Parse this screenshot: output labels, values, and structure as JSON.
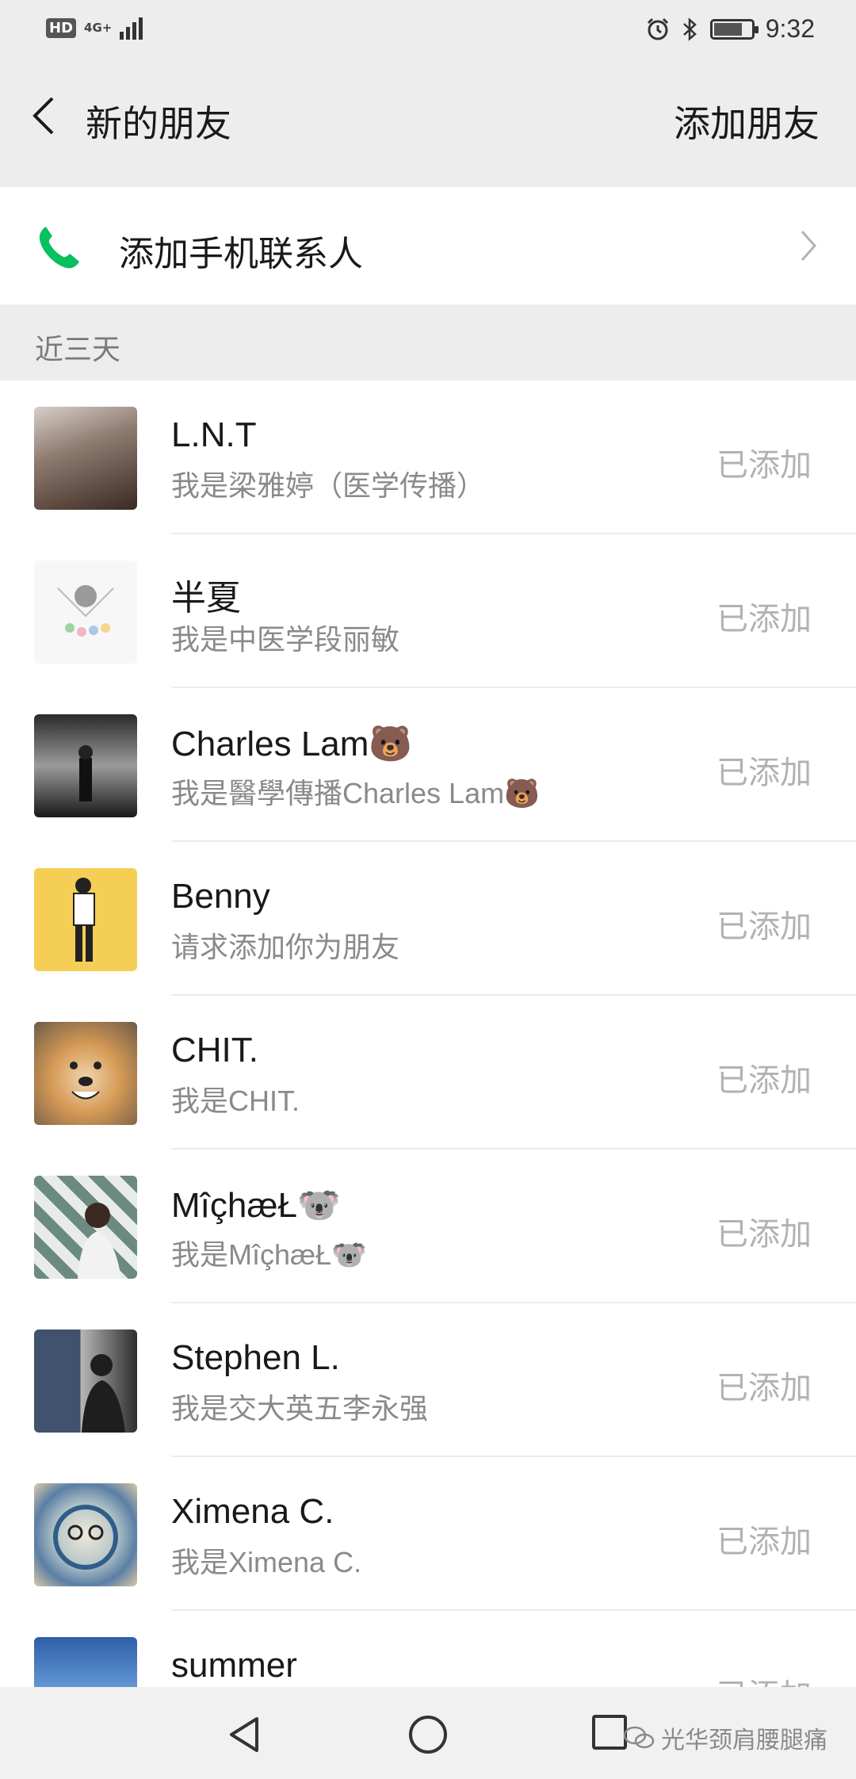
{
  "status_bar": {
    "hd": "HD",
    "network": "4G+",
    "time": "9:32",
    "icons": [
      "alarm-icon",
      "bluetooth-icon",
      "battery-icon"
    ]
  },
  "nav": {
    "title": "新的朋友",
    "action": "添加朋友"
  },
  "add_contacts": {
    "label": "添加手机联系人",
    "icon": "phone-icon",
    "icon_color": "#07c160"
  },
  "section": {
    "title": "近三天"
  },
  "friends": [
    {
      "name": "L.N.T",
      "message": "我是梁雅婷（医学传播）",
      "status": "已添加"
    },
    {
      "name": "半夏",
      "message": "我是中医学段丽敏",
      "status": "已添加"
    },
    {
      "name": "Charles Lam🐻",
      "message": "我是醫學傳播Charles Lam🐻",
      "status": "已添加"
    },
    {
      "name": "Benny",
      "message": "请求添加你为朋友",
      "status": "已添加"
    },
    {
      "name": "CHIT.",
      "message": "我是CHIT.",
      "status": "已添加"
    },
    {
      "name": "MîçhæŁ🐨",
      "message": "我是MîçhæŁ🐨",
      "status": "已添加"
    },
    {
      "name": "Stephen L.",
      "message": "我是交大英五李永强",
      "status": "已添加"
    },
    {
      "name": "Ximena C.",
      "message": "我是Ximena C.",
      "status": "已添加"
    },
    {
      "name": "summer",
      "message": "",
      "status": "已添加"
    }
  ],
  "bottom_nav": {
    "watermark": "光华颈肩腰腿痛"
  },
  "colors": {
    "background": "#ededed",
    "accent_green": "#07c160",
    "secondary_text": "#8a8a8a",
    "status_text": "#b2b2b2"
  }
}
